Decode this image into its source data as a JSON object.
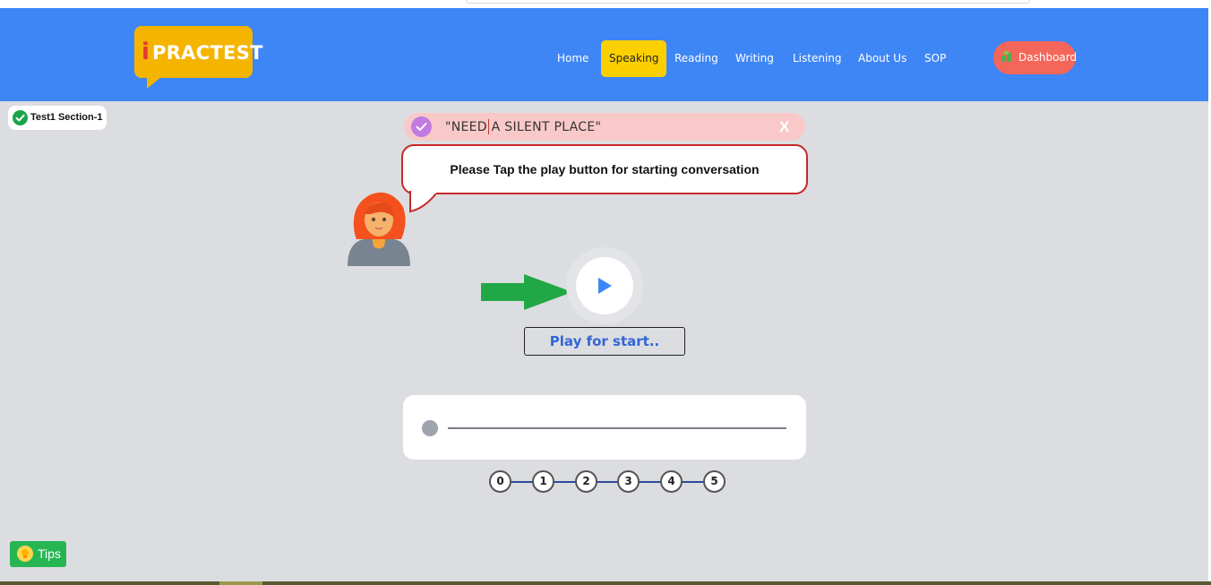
{
  "brand": {
    "logo_i": "i",
    "logo_text": "PRACTEST"
  },
  "nav": {
    "items": [
      {
        "label": "Home",
        "active": false
      },
      {
        "label": "Speaking",
        "active": true
      },
      {
        "label": "Reading",
        "active": false
      },
      {
        "label": "Writing",
        "active": false
      },
      {
        "label": "Listening",
        "active": false
      },
      {
        "label": "About Us",
        "active": false
      },
      {
        "label": "SOP",
        "active": false
      }
    ],
    "dashboard_label": "Dashboard"
  },
  "section_badge": {
    "label": "Test1 Section-1"
  },
  "prompt": {
    "text": "\"NEED A SILENT PLACE\"",
    "close_label": "X"
  },
  "bubble": {
    "text": "Please Tap the play button for starting conversation"
  },
  "player": {
    "label": "Play for start..",
    "progress": 0
  },
  "steps": [
    "0",
    "1",
    "2",
    "3",
    "4",
    "5"
  ],
  "tips": {
    "label": "Tips"
  },
  "colors": {
    "header": "#3e86f5",
    "nav_active": "#fcd000",
    "dashboard": "#f4665a",
    "prompt_bg": "#f9c9c9",
    "bubble_border": "#c62828",
    "play_icon": "#3e86f5",
    "arrow": "#21a846",
    "tips": "#27b554"
  },
  "icons": {
    "section_check": "check-circle-icon",
    "prompt_check": "check-circle-icon",
    "play": "play-icon",
    "arrow": "arrow-right-icon",
    "tips": "lightbulb-icon",
    "dashboard": "dashboard-icon",
    "avatar": "woman-avatar-icon"
  }
}
